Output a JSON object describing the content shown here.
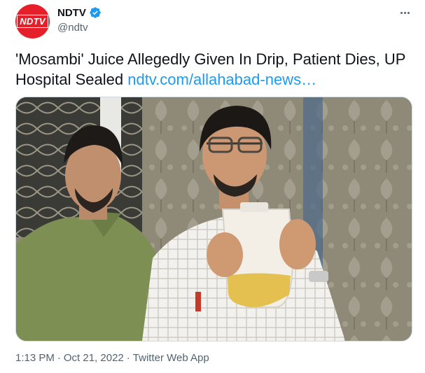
{
  "account": {
    "avatar_text": "NDTV",
    "display_name": "NDTV",
    "handle": "@ndtv",
    "verified": true
  },
  "tweet": {
    "text": "'Mosambi' Juice Allegedly Given In Drip, Patient Dies, UP Hospital Sealed ",
    "link_text": "ndtv.com/allahabad-news…"
  },
  "media": {
    "description_icon": "photo-image"
  },
  "meta": {
    "time": "1:13 PM",
    "separator": "·",
    "date": "Oct 21, 2022",
    "source": "Twitter Web App"
  },
  "colors": {
    "brand_red": "#e6202a",
    "link_blue": "#1d9bf0",
    "secondary_text": "#536471"
  },
  "icons": {
    "verified": "verified-badge-icon",
    "more": "more-options-icon"
  }
}
